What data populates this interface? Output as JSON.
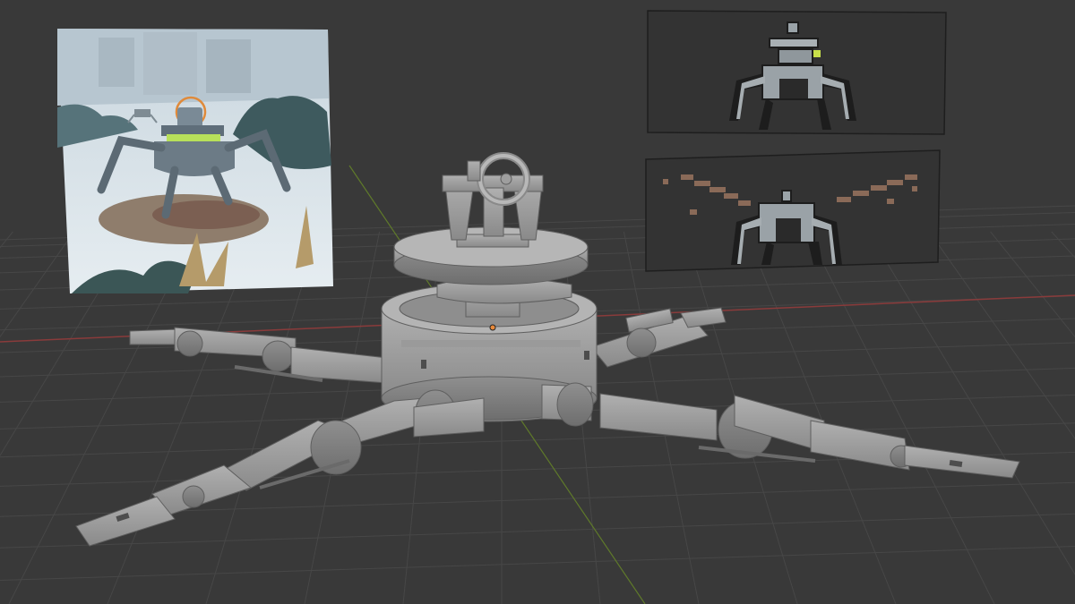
{
  "app": {
    "name": "3D viewport"
  },
  "viewport": {
    "background": "#393939",
    "grid_color": "#474747",
    "x_axis_color": "#8a3b3b",
    "y_axis_color": "#5f7a2a"
  },
  "references": [
    {
      "kind": "concept-art-reference",
      "subject": "spider-mech-in-snow"
    },
    {
      "kind": "pixel-art-reference",
      "subject": "spider-mech-front-view"
    },
    {
      "kind": "pixel-art-reference",
      "subject": "spider-mech-with-wings"
    }
  ],
  "model": {
    "subject": "spider-mech-blockout",
    "material_color": "#9b9b9b",
    "legs": 4,
    "origin_marker_color": "#e8893a"
  }
}
